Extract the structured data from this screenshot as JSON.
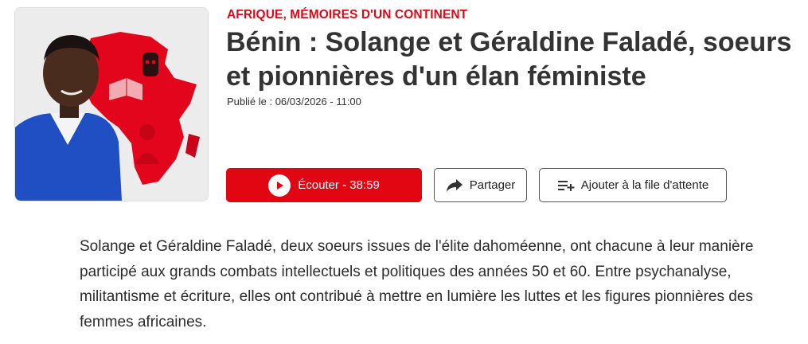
{
  "episode": {
    "category": "AFRIQUE, MÉMOIRES D'UN CONTINENT",
    "title": "Bénin : Solange et Géraldine Faladé, soeurs et pionnières d'un élan féministe",
    "published": "Publié le : 06/03/2026 - 11:00",
    "summary": "Solange et Géraldine Faladé, deux soeurs issues de l'élite dahoméenne, ont chacune à leur manière participé aux grands combats intellectuels et politiques des années 50 et 60. Entre psychanalyse, militantisme et écriture, elles ont contribué à mettre en lumière les luttes et les figures pionnières des femmes africaines."
  },
  "actions": {
    "listen_label": "Écouter - 38:59",
    "share_label": "Partager",
    "queue_label": "Ajouter à la file d'attente"
  },
  "icons": {
    "play": "play-icon",
    "share": "share-arrow-icon",
    "queue": "playlist-add-icon"
  },
  "colors": {
    "accent": "#e20613",
    "category": "#e00814",
    "title": "#333333"
  }
}
